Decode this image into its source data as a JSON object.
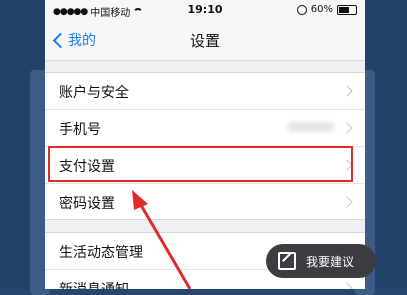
{
  "status": {
    "carrier": "中国移动",
    "time": "19:10",
    "battery": "60%"
  },
  "nav": {
    "back_label": "我的",
    "title": "设置"
  },
  "group1": [
    {
      "label": "账户与安全"
    },
    {
      "label": "手机号"
    },
    {
      "label": "支付设置"
    },
    {
      "label": "密码设置"
    }
  ],
  "group2": [
    {
      "label": "生活动态管理"
    },
    {
      "label": "新消息通知"
    }
  ],
  "suggest": {
    "label": "我要建议"
  },
  "colors": {
    "accent": "#1a7cf2",
    "highlight": "#e02a2a",
    "arrow": "#e02a2a"
  }
}
